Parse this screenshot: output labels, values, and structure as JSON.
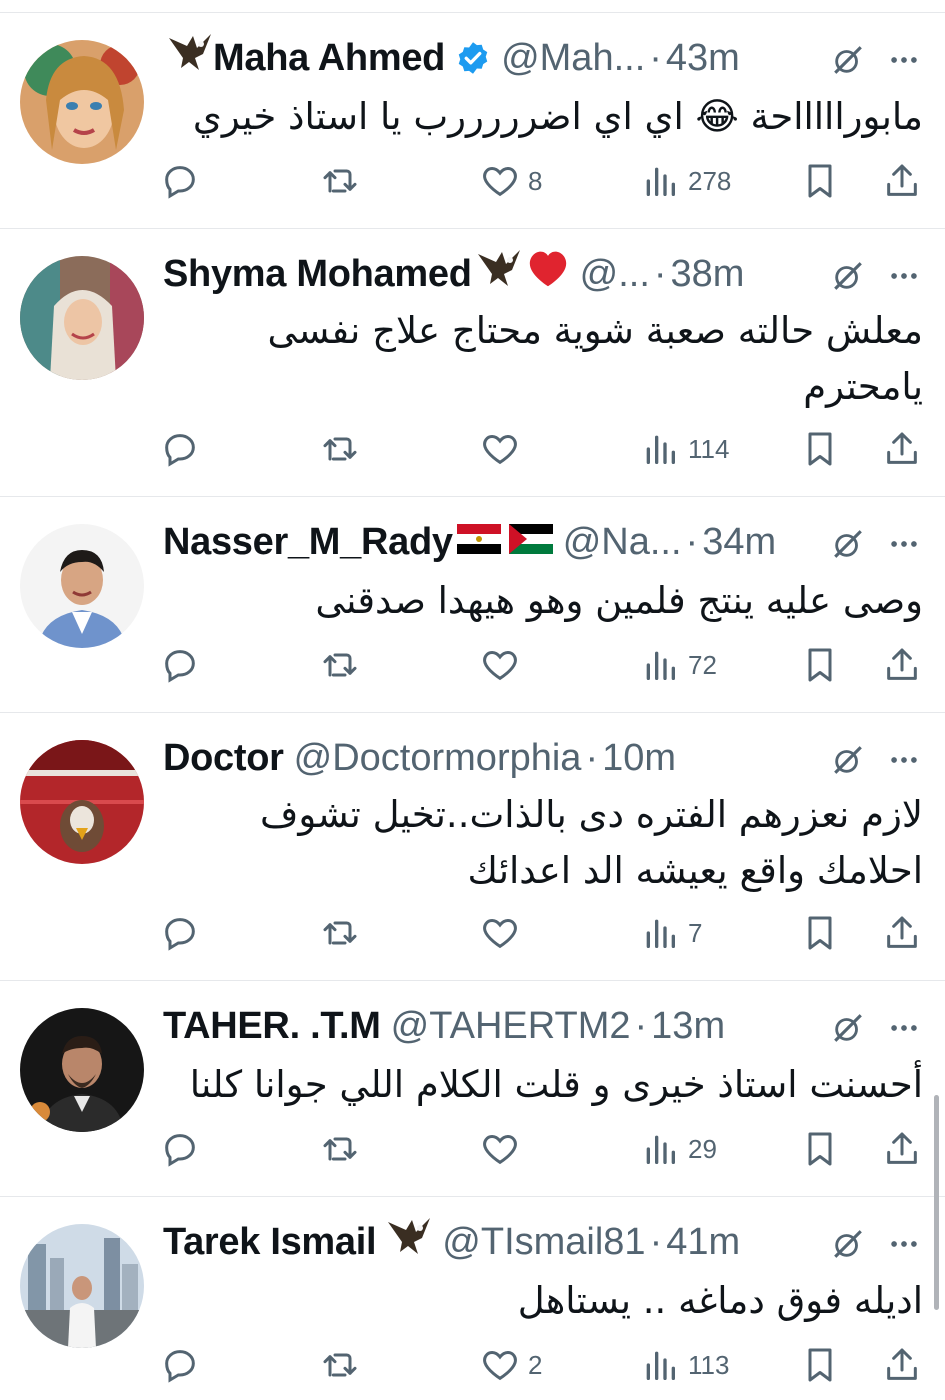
{
  "tweets": [
    {
      "name": "Maha Ahmed",
      "handle": "@Mah...",
      "time": "43m",
      "verified": true,
      "name_emojis": [
        "eagle-emoji"
      ],
      "text": "مابوراااااحة 😂 اي اي اضرررررب يا استاذ خيري",
      "replies": "",
      "retweets": "",
      "likes": "8",
      "views": "278",
      "avatar_color": "#e9c9a8"
    },
    {
      "name": "Shyma Mohamed",
      "handle": "@...",
      "time": "38m",
      "verified": false,
      "name_emojis": [
        "eagle-emoji",
        "heart-emoji"
      ],
      "text": "معلش حالته صعبة شوية محتاج علاج نفسى يامحترم",
      "replies": "",
      "retweets": "",
      "likes": "",
      "views": "114",
      "avatar_color": "#d7b7a4"
    },
    {
      "name": "Nasser_M_Rady",
      "handle": "@Na...",
      "time": "34m",
      "verified": false,
      "name_emojis": [
        "egypt-flag-emoji",
        "palestine-flag-emoji"
      ],
      "text": "وصى عليه ينتج فلمين وهو هيهدا صدقنى",
      "replies": "",
      "retweets": "",
      "likes": "",
      "views": "72",
      "avatar_color": "#6d8fc0"
    },
    {
      "name": "Doctor",
      "handle": "@Doctormorphia",
      "time": "10m",
      "verified": false,
      "name_emojis": [],
      "text": "لازم نعزرهم الفتره دى بالذات..تخيل تشوف احلامك واقع يعيشه الد اعدائك",
      "replies": "",
      "retweets": "",
      "likes": "",
      "views": "7",
      "avatar_color": "#b3262a"
    },
    {
      "name": "TAHER. .T.M",
      "handle": "@TAHERTM2",
      "time": "13m",
      "verified": false,
      "name_emojis": [],
      "text": "أحسنت استاذ خيرى و قلت الكلام اللي جوانا كلنا",
      "replies": "",
      "retweets": "",
      "likes": "",
      "views": "29",
      "avatar_color": "#1c1c1c"
    },
    {
      "name": "Tarek Ismail",
      "handle": "@TIsmail81",
      "time": "41m",
      "verified": false,
      "name_emojis": [
        "eagle-emoji"
      ],
      "text": "اديله فوق دماغه .. يستاهل",
      "replies": "",
      "retweets": "",
      "likes": "2",
      "views": "113",
      "avatar_color": "#9fb4c8"
    }
  ],
  "icons": {
    "reply": "reply-icon",
    "retweet": "retweet-icon",
    "like": "heart-icon",
    "views": "views-icon",
    "bookmark": "bookmark-icon",
    "share": "share-icon",
    "grok": "grok-icon",
    "more": "more-icon",
    "verified": "verified-badge-icon"
  },
  "colors": {
    "text": "#0f1419",
    "secondary": "#536471",
    "verified": "#1d9bf0",
    "divider": "#e6e8eb"
  }
}
